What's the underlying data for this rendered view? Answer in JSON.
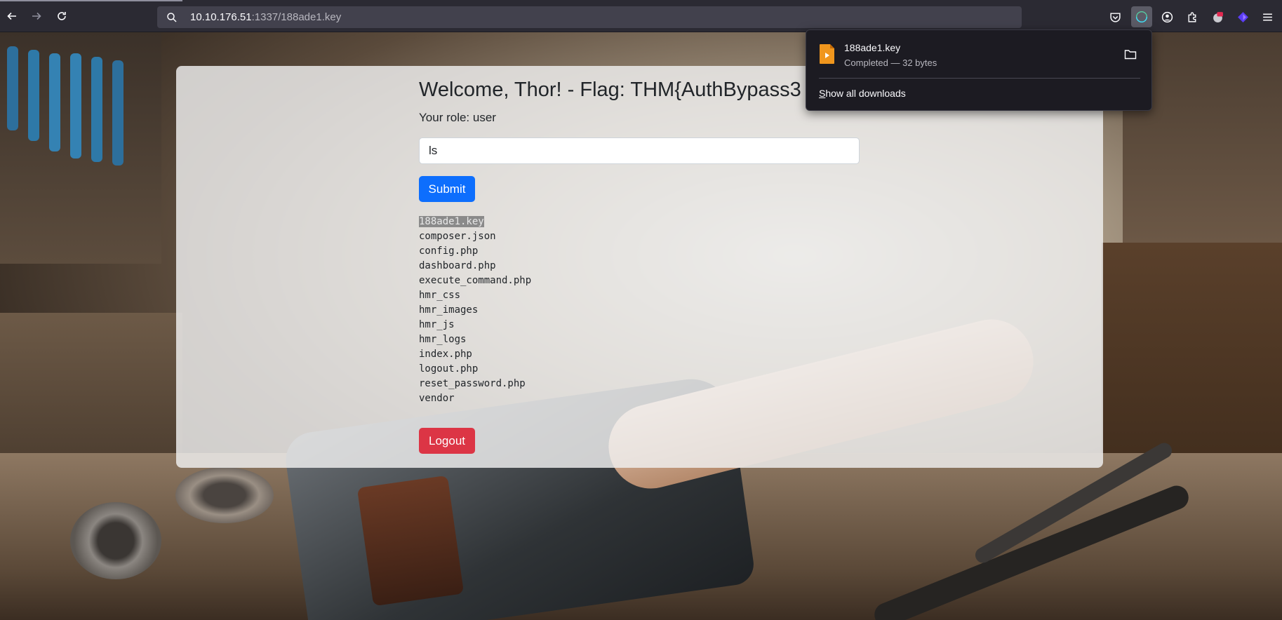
{
  "browser": {
    "url_host": "10.10.176.51",
    "url_rest": ":1337/188ade1.key"
  },
  "downloads": {
    "file_name": "188ade1.key",
    "status": "Completed — 32 bytes",
    "show_all_first": "S",
    "show_all_rest": "how all downloads"
  },
  "page": {
    "welcome": "Welcome, Thor! - Flag: THM{AuthBypass3",
    "role": "Your role: user",
    "command_value": "ls",
    "submit_label": "Submit",
    "logout_label": "Logout",
    "listing": [
      "188ade1.key",
      "composer.json",
      "config.php",
      "dashboard.php",
      "execute_command.php",
      "hmr_css",
      "hmr_images",
      "hmr_js",
      "hmr_logs",
      "index.php",
      "logout.php",
      "reset_password.php",
      "vendor"
    ]
  },
  "colors": {
    "submit": "#0d6efd",
    "logout": "#dc3545",
    "file_icon": "#f0961d"
  },
  "icons": {
    "back": "back-arrow-icon",
    "forward": "forward-arrow-icon",
    "reload": "reload-icon",
    "search": "search-icon",
    "pocket": "pocket-icon",
    "downloads": "download-icon",
    "account": "account-icon",
    "extensions": "extensions-icon",
    "menu": "hamburger-menu-icon",
    "folder": "folder-icon"
  }
}
